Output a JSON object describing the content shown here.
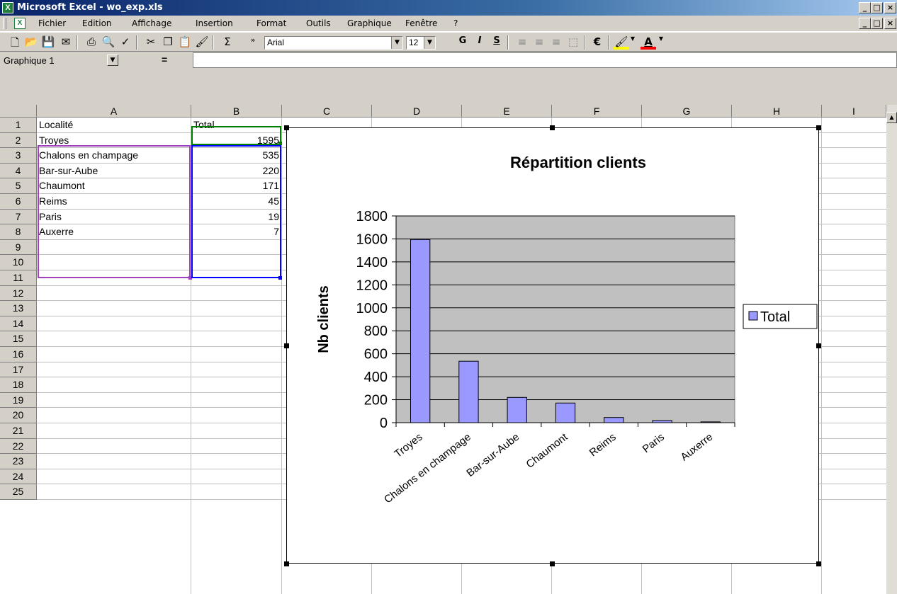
{
  "window": {
    "title": "Microsoft Excel - wo_exp.xls",
    "btn_min": "_",
    "btn_max": "□",
    "btn_close": "×"
  },
  "menu": {
    "items": [
      "Fichier",
      "Edition",
      "Affichage",
      "Insertion",
      "Format",
      "Outils",
      "Graphique",
      "Fenêtre",
      "?"
    ]
  },
  "toolbar": {
    "font_name": "Arial",
    "font_size": "12",
    "bold_label": "G",
    "italic_label": "I",
    "underline_label": "S",
    "sum_label": "Σ",
    "euro_label": "€"
  },
  "formula_bar": {
    "name_box": "Graphique 1",
    "equals": "="
  },
  "sheet": {
    "columns": [
      "A",
      "B",
      "C",
      "D",
      "E",
      "F",
      "G",
      "H",
      "I"
    ],
    "rows": [
      "1",
      "2",
      "3",
      "4",
      "5",
      "6",
      "7",
      "8",
      "9",
      "10",
      "11",
      "12",
      "13",
      "14",
      "15",
      "16",
      "17",
      "18",
      "19",
      "20",
      "21",
      "22",
      "23",
      "24",
      "25"
    ],
    "cells": {
      "A1": "Localité",
      "B1": "Total",
      "A2": "Troyes",
      "B2": "1595",
      "A3": "Chalons en champage",
      "B3": "535",
      "A4": "Bar-sur-Aube",
      "B4": "220",
      "A5": "Chaumont",
      "B5": "171",
      "A6": "Reims",
      "B6": "45",
      "A7": "Paris",
      "B7": "19",
      "A8": "Auxerre",
      "B8": "7"
    }
  },
  "colors": {
    "bar_fill": "#9999ff",
    "plot_bg": "#c0c0c0",
    "selection_purple": "#a040c0",
    "selection_green": "#008000",
    "selection_blue": "#0000ff"
  },
  "chart_data": {
    "type": "bar",
    "title": "Répartition clients",
    "ylabel": "Nb clients",
    "xlabel": "",
    "categories": [
      "Troyes",
      "Chalons en champage",
      "Bar-sur-Aube",
      "Chaumont",
      "Reims",
      "Paris",
      "Auxerre"
    ],
    "series": [
      {
        "name": "Total",
        "values": [
          1595,
          535,
          220,
          171,
          45,
          19,
          7
        ]
      }
    ],
    "ylim": [
      0,
      1800
    ],
    "yticks": [
      0,
      200,
      400,
      600,
      800,
      1000,
      1200,
      1400,
      1600,
      1800
    ],
    "grid": true,
    "legend": "right"
  }
}
